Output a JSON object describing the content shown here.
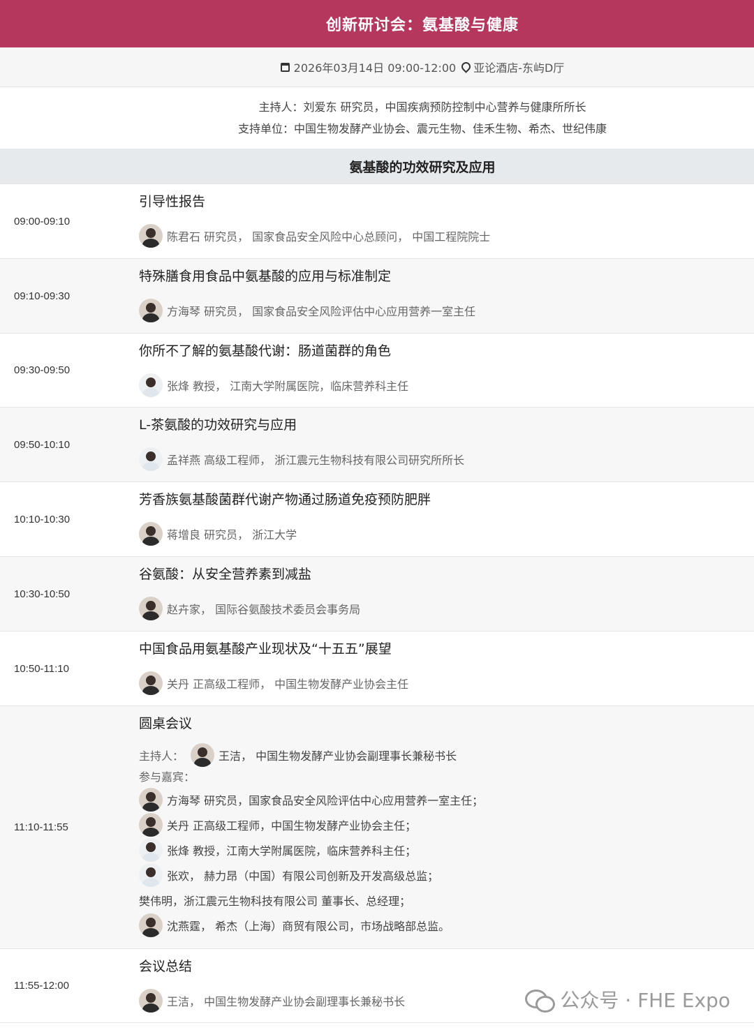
{
  "header": {
    "title": "创新研讨会：氨基酸与健康"
  },
  "meta": {
    "date": "2026年03月14日 09:00-12:00",
    "venue": "亚论酒店-东屿D厅"
  },
  "host": {
    "moderator": "主持人：刘爱东 研究员，中国疾病预防控制中心营养与健康所所长",
    "support": "支持单位：中国生物发酵产业协会、震元生物、佳禾生物、希杰、世纪伟康"
  },
  "section": {
    "title": "氨基酸的功效研究及应用"
  },
  "agenda": [
    {
      "time": "09:00-09:10",
      "title": "引导性报告",
      "speaker": "陈君石 研究员， 国家食品安全风险中心总顾问， 中国工程院院士"
    },
    {
      "time": "09:10-09:30",
      "title": "特殊膳食用食品中氨基酸的应用与标准制定",
      "speaker": "方海琴 研究员， 国家食品安全风险评估中心应用营养一室主任"
    },
    {
      "time": "09:30-09:50",
      "title": "你所不了解的氨基酸代谢：肠道菌群的角色",
      "speaker": "张烽 教授， 江南大学附属医院，临床营养科主任"
    },
    {
      "time": "09:50-10:10",
      "title": "L-茶氨酸的功效研究与应用",
      "speaker": "孟祥燕 高级工程师， 浙江震元生物科技有限公司研究所所长"
    },
    {
      "time": "10:10-10:30",
      "title": "芳香族氨基酸菌群代谢产物通过肠道免疫预防肥胖",
      "speaker": "蒋增良 研究员， 浙江大学"
    },
    {
      "time": "10:30-10:50",
      "title": "谷氨酸：从安全营养素到减盐",
      "speaker": "赵卉家， 国际谷氨酸技术委员会事务局"
    },
    {
      "time": "10:50-11:10",
      "title": "中国食品用氨基酸产业现状及“十五五”展望",
      "speaker": "关丹 正高级工程师， 中国生物发酵产业协会主任"
    }
  ],
  "roundtable": {
    "time": "11:10-11:55",
    "title": "圆桌会议",
    "host_label": "主持人：",
    "host": "王洁， 中国生物发酵产业协会副理事长兼秘书长",
    "guests_label": "参与嘉宾：",
    "guests": [
      "方海琴 研究员，国家食品安全风险评估中心应用营养一室主任；",
      "关丹 正高级工程师，中国生物发酵产业协会主任；",
      "张烽 教授，江南大学附属医院，临床营养科主任；",
      "张欢， 赫力昂（中国）有限公司创新及开发高级总监；",
      "樊伟明，浙江震元生物科技有限公司 董事长、总经理；",
      "沈燕霆， 希杰（上海）商贸有限公司，市场战略部总监。"
    ]
  },
  "summary": {
    "time": "11:55-12:00",
    "title": "会议总结",
    "speaker": "王洁， 中国生物发酵产业协会副理事长兼秘书长"
  },
  "watermark": {
    "text": "公众号 · FHE Expo"
  }
}
